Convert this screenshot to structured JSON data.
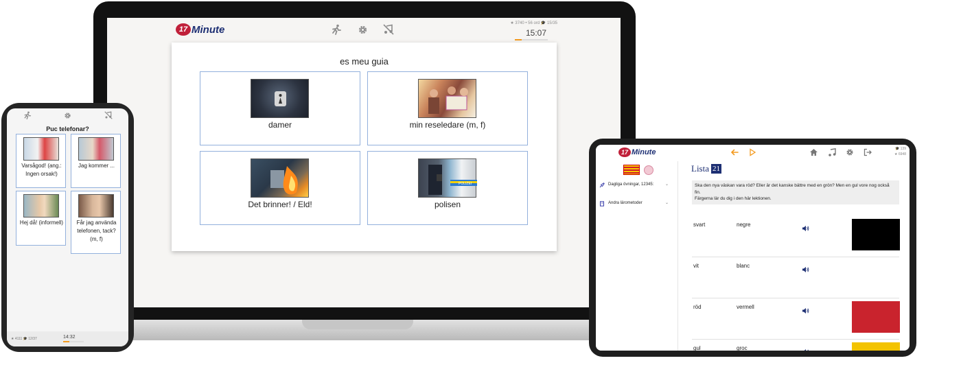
{
  "colors": {
    "accent": "#f39a1e",
    "brand_red": "#c0203a",
    "brand_blue": "#1d2f73",
    "option_border": "#92b0dc"
  },
  "brand": {
    "badge": "17",
    "word": "Minute"
  },
  "laptop": {
    "icons": [
      "running-person-icon",
      "gear-icon",
      "no-music-icon"
    ],
    "stats": "★ 3740  • 56 ord  🎓 15/35",
    "clock": "15:07",
    "progress": 0.2,
    "question": "es meu guia",
    "options": [
      {
        "label": "damer",
        "image": "women-restroom-sign"
      },
      {
        "label": "min reseledare (m, f)",
        "image": "tour-group-with-map"
      },
      {
        "label": "Det brinner! / Eld!",
        "image": "fire-at-outlet"
      },
      {
        "label": "polisen",
        "image": "police-car-officer"
      }
    ]
  },
  "phone": {
    "icons": [
      "running-person-icon",
      "gear-icon",
      "no-music-icon"
    ],
    "question": "Puc telefonar?",
    "options": [
      {
        "label": "Varsågod! (ang.: Ingen orsak!)",
        "image": "pharmacist-serving"
      },
      {
        "label": "Jag kommer ...",
        "image": "couple-with-luggage"
      },
      {
        "label": "Hej då! (informell)",
        "image": "woman-waving"
      },
      {
        "label": "Får jag använda telefonen, tack? (m, f)",
        "image": "woman-on-phone"
      }
    ],
    "stats": "★ 4111  🎓 12/37",
    "clock": "14:32",
    "progress": 0.3
  },
  "tablet": {
    "stats": [
      "🎓 139",
      "★ 6948"
    ],
    "menu": [
      {
        "label": "Dagliga övningar, 12345:",
        "icon": "rocket-icon"
      },
      {
        "label": "Andra lärometoder",
        "icon": "book-icon"
      }
    ],
    "list_title": "Lista",
    "list_number": "21",
    "description_lines": [
      "Ska den nya väskan vara röd? Eller är det kanske bättre med en grön? Men en gul vore nog också",
      "fin.",
      "Färgerna lär du dig i den här lektionen."
    ],
    "vocab": [
      {
        "sv": "svart",
        "ca": "negre",
        "color": "#000000"
      },
      {
        "sv": "vit",
        "ca": "blanc",
        "color": "#ffffff"
      },
      {
        "sv": "röd",
        "ca": "vermell",
        "color": "#c9232d"
      },
      {
        "sv": "gul",
        "ca": "groc",
        "color": "#f3c300"
      }
    ]
  }
}
